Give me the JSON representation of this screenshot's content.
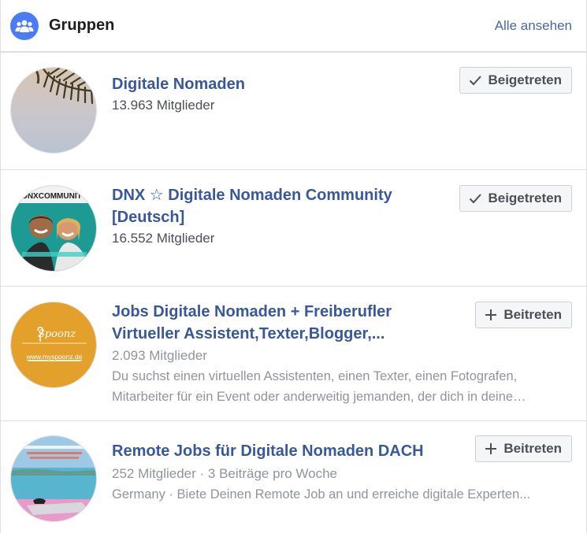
{
  "header": {
    "title": "Gruppen",
    "see_all": "Alle ansehen"
  },
  "groups": [
    {
      "name": "Digitale Nomaden",
      "members": "13.963 Mitglieder",
      "button": "Beigetreten",
      "button_icon": "check-icon"
    },
    {
      "name_line1": "DNX ☆ Digitale Nomaden Community",
      "name_line2": "[Deutsch]",
      "members": "16.552 Mitglieder",
      "button": "Beigetreten",
      "button_icon": "check-icon",
      "avatar_text": "DNXCOMMUNITY"
    },
    {
      "name_line1": "Jobs Digitale Nomaden + Freiberufler",
      "name_line2": "Virtueller Assistent,Texter,Blogger,...",
      "members": "2.093 Mitglieder",
      "desc_line1": "Du suchst einen virtuellen Assistenten, einen Texter, einen Fotografen,",
      "desc_line2": "Mitarbeiter für ein Event oder anderweitig jemanden, der dich in deine…",
      "button": "Beitreten",
      "button_icon": "plus-icon",
      "avatar_text": "Spoonz",
      "avatar_url": "www.myspoonz.de"
    },
    {
      "name": "Remote Jobs für Digitale Nomaden DACH",
      "members": "252 Mitglieder · 3 Beiträge pro Woche",
      "desc": "Germany · Biete Deinen Remote Job an und erreiche digitale Experten...",
      "button": "Beitreten",
      "button_icon": "plus-icon"
    }
  ],
  "colors": {
    "link": "#385898",
    "header_icon_bg": "#4c7cf5",
    "button_bg": "#f5f6f7",
    "muted_text": "#90949c"
  }
}
